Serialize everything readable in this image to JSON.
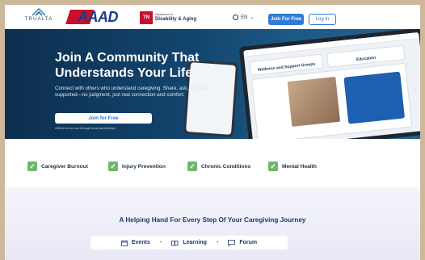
{
  "nav": {
    "trualta_label": "TRUALTA",
    "aaad_label": "AAAD",
    "tn_badge": "TN",
    "tn_dept": "Department of",
    "tn_name": "Disability & Aging",
    "lang": "EN",
    "join_label": "Join For Free",
    "login_label": "Log In"
  },
  "hero": {
    "title": "Join A Community That Understands Your Life.",
    "subtitle": "Connect with others who understand caregiving. Share, ask, and feel supported—no judgment, just real connection and comfort.",
    "cta_label": "Join for Free",
    "note": "Offered at no cost through local partnerships",
    "laptop_card1": "Wellness and Support Groups",
    "laptop_card2": "Education"
  },
  "features": [
    {
      "label": "Caregiver Burnout"
    },
    {
      "label": "Injury Prevention"
    },
    {
      "label": "Chronic Conditions"
    },
    {
      "label": "Mental Health"
    }
  ],
  "journey": {
    "title": "A Helping Hand For Every Step Of Your Caregiving Journey",
    "tabs": [
      {
        "label": "Events",
        "icon": "calendar-icon"
      },
      {
        "label": "Learning",
        "icon": "book-icon"
      },
      {
        "label": "Forum",
        "icon": "chat-icon"
      }
    ]
  },
  "colors": {
    "primary": "#2f7bd9",
    "hero_bg": "#12456e",
    "check_green": "#6bb86a",
    "aaad_red": "#c8102e",
    "aaad_blue": "#1a3a8a"
  }
}
